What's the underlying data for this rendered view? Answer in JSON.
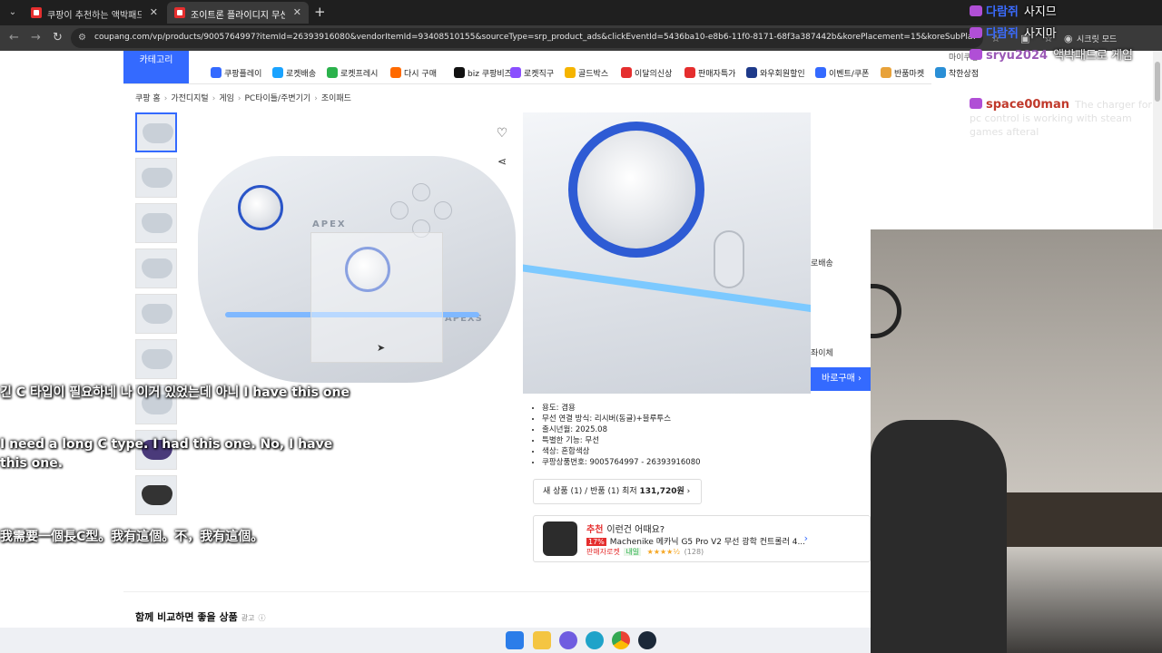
{
  "browser": {
    "tabs": [
      {
        "title": "쿠팡이 추천하는 액박패드 관련",
        "active": false
      },
      {
        "title": "조이트론 플라이디지 무선 PC",
        "active": true
      }
    ],
    "url": "coupang.com/vp/products/9005764997?itemId=26393916080&vendorItemId=93408510155&sourceType=srp_product_ads&clickEventId=5436ba10-e8b6-11f0-8171-68f3a387442b&korePlacement=15&koreSubPlacement=37&clic...",
    "mode_label": "시크릿 모드"
  },
  "site": {
    "category_button": "카테고리",
    "mypage": "마이쿠팡",
    "nav": [
      {
        "label": "쿠팡플레이",
        "color": "#346aff"
      },
      {
        "label": "로켓배송",
        "color": "#1aa3ff"
      },
      {
        "label": "로켓프레시",
        "color": "#2bb24c"
      },
      {
        "label": "다시 구매",
        "color": "#ff6a00"
      },
      {
        "label": "biz 쿠팡비즈",
        "color": "#111111"
      },
      {
        "label": "로켓직구",
        "color": "#8a4fff"
      },
      {
        "label": "골드박스",
        "color": "#f5b400"
      },
      {
        "label": "이달의신상",
        "color": "#e52e2e"
      },
      {
        "label": "판매자특가",
        "color": "#e52e2e"
      },
      {
        "label": "와우회원할인",
        "color": "#1e3a8a"
      },
      {
        "label": "이벤트/쿠폰",
        "color": "#346aff"
      },
      {
        "label": "반품마켓",
        "color": "#e8a23a"
      },
      {
        "label": "착한상점",
        "color": "#2a8fd6"
      }
    ],
    "new_badge": "N"
  },
  "breadcrumb": [
    "쿠팡 홈",
    "가전디지털",
    "게임",
    "PC타이틀/주변기기",
    "조이패드"
  ],
  "product": {
    "brand_marks": [
      "APEX",
      "APEXS"
    ],
    "specs": [
      "용도: 겸용",
      "무선 연결 방식: 리시버(동글)+블루투스",
      "출시년월: 2025.08",
      "특별한 기능: 무선",
      "색상: 혼합색상",
      "쿠팡상품번호: 9005764997 - 26393916080"
    ],
    "stock_button": "새 상품 (1) / 반품 (1) 최저",
    "stock_price": "131,720원",
    "side_fragments": {
      "delivery": "로배송",
      "change": "좌이체"
    },
    "buy_now": "바로구매"
  },
  "recommend": {
    "label": "추천",
    "question": "이런건 어때요?",
    "discount": "17%",
    "name": "Machenike 메카닉 G5 Pro V2 무선 광학 컨트롤러 4...",
    "seller": "판매자로켓",
    "badge": "내일",
    "stars": "★★★★½",
    "reviews": "(128)"
  },
  "section_title": "함께 비교하면 좋을 상품",
  "section_ad": "광고",
  "chat": [
    {
      "name": "다람쥐",
      "name_color": "#3b6cff",
      "text": "사지므"
    },
    {
      "name": "다람쥐",
      "name_color": "#3b6cff",
      "text": "사지마"
    },
    {
      "name": "sryu2024",
      "name_color": "#9b59b6",
      "text": "액박패드로 게임"
    },
    {
      "name": "space00man",
      "name_color": "#c0392b",
      "text": "The charger for pc control is working with steam games afteral"
    }
  ],
  "subtitles": [
    "긴 C 타입이 필요하네 나 이거 있었는데 아니 I have this one",
    "I need a long C type. I had this one. No, I have this one.",
    "我需要一個長C型。我有這個。不，我有這個。"
  ]
}
